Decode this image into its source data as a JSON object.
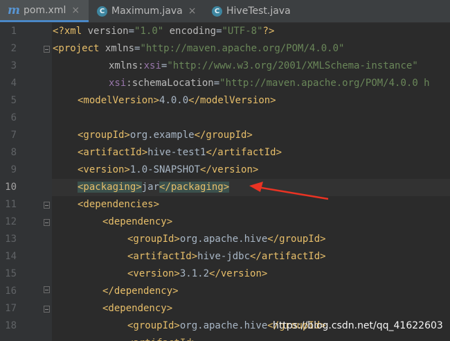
{
  "tabs": [
    {
      "label": "pom.xml",
      "icon": "maven-file-icon",
      "active": true,
      "close": "×"
    },
    {
      "label": "Maximum.java",
      "icon": "java-class-icon",
      "active": false,
      "close": "×"
    },
    {
      "label": "HiveTest.java",
      "icon": "java-class-icon",
      "active": false,
      "close": ""
    }
  ],
  "tab_icon_glyphs": {
    "maven": "m",
    "java": "C"
  },
  "current_line": 10,
  "line_numbers": [
    "1",
    "2",
    "3",
    "4",
    "5",
    "6",
    "7",
    "8",
    "9",
    "10",
    "11",
    "12",
    "13",
    "14",
    "15",
    "16",
    "17",
    "18"
  ],
  "code": {
    "l1": {
      "a": "<?xml ",
      "b": "version",
      "c": "=",
      "d": "\"1.0\"",
      "e": " ",
      "f": "encoding",
      "g": "=",
      "h": "\"UTF-8\"",
      "i": "?>"
    },
    "l2": {
      "a": "<project ",
      "b": "xmlns",
      "c": "=",
      "d": "\"http://maven.apache.org/POM/4.0.0\""
    },
    "l3": {
      "a": "xmlns",
      "b": ":",
      "c": "xsi",
      "d": "=",
      "e": "\"http://www.w3.org/2001/XMLSchema-instance\""
    },
    "l4": {
      "a": "xsi",
      "b": ":schemaLocation",
      "c": "=",
      "d": "\"http://maven.apache.org/POM/4.0.0 h"
    },
    "l5": {
      "a": "<modelVersion>",
      "b": "4.0.0",
      "c": "</modelVersion>"
    },
    "l7": {
      "a": "<groupId>",
      "b": "org.example",
      "c": "</groupId>"
    },
    "l8": {
      "a": "<artifactId>",
      "b": "hive-test1",
      "c": "</artifactId>"
    },
    "l9": {
      "a": "<version>",
      "b": "1.0-SNAPSHOT",
      "c": "</version>"
    },
    "l10": {
      "a": "<packaging>",
      "b": "jar",
      "c": "</packaging>"
    },
    "l11": {
      "a": "<dependencies>"
    },
    "l12": {
      "a": "<dependency>"
    },
    "l13": {
      "a": "<groupId>",
      "b": "org.apache.hive",
      "c": "</groupId>"
    },
    "l14": {
      "a": "<artifactId>",
      "b": "hive-jdbc",
      "c": "</artifactId>"
    },
    "l15": {
      "a": "<version>",
      "b": "3.1.2",
      "c": "</version>"
    },
    "l16": {
      "a": "</dependency>"
    },
    "l17": {
      "a": "<dependency>"
    },
    "l18": {
      "a": "<groupId>",
      "b": "org.apache.hive",
      "c": "</groupId>"
    }
  },
  "watermark": "https://blog.csdn.net/qq_41622603",
  "colors": {
    "tag": "#e8bf6a",
    "string": "#6a8759",
    "namespace": "#9876aa",
    "text": "#a9b7c6",
    "annotation_arrow": "#ea3323",
    "bulb": "#f5c445"
  }
}
